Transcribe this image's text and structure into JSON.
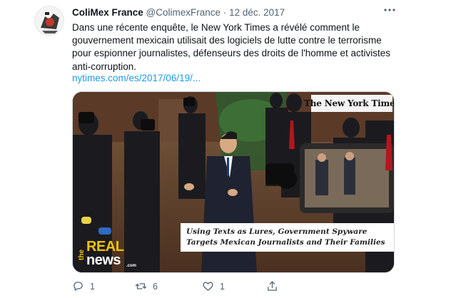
{
  "tweet": {
    "author_name": "ColiMex France",
    "handle": "@ColimexFrance",
    "separator": "·",
    "date": "12 déc. 2017",
    "text": "Dans une récente enquête, le New York Times a révélé comment le gouvernement mexicain utilisait des logiciels de lutte contre le terrorisme pour espionner journalistes, défenseurs des droits de l'homme et activistes anti-corruption.",
    "link": "nytimes.com/es/2017/06/19/..."
  },
  "media": {
    "nyt_logo_text": "The New York Times",
    "caption_line1": "Using Texts as Lures, Government Spyware",
    "caption_line2": "Targets Mexican Journalists and Their Families",
    "watermark_the": "the",
    "watermark_real": "REAL",
    "watermark_news": "news",
    "watermark_com": ".com"
  },
  "actions": {
    "reply_count": "1",
    "retweet_count": "6",
    "like_count": "1"
  },
  "icons": {
    "more": "more-options-icon",
    "reply": "reply-icon",
    "retweet": "retweet-icon",
    "like": "heart-icon",
    "share": "share-icon"
  },
  "colors": {
    "link": "#1d9bf0",
    "secondary_text": "#536471"
  }
}
